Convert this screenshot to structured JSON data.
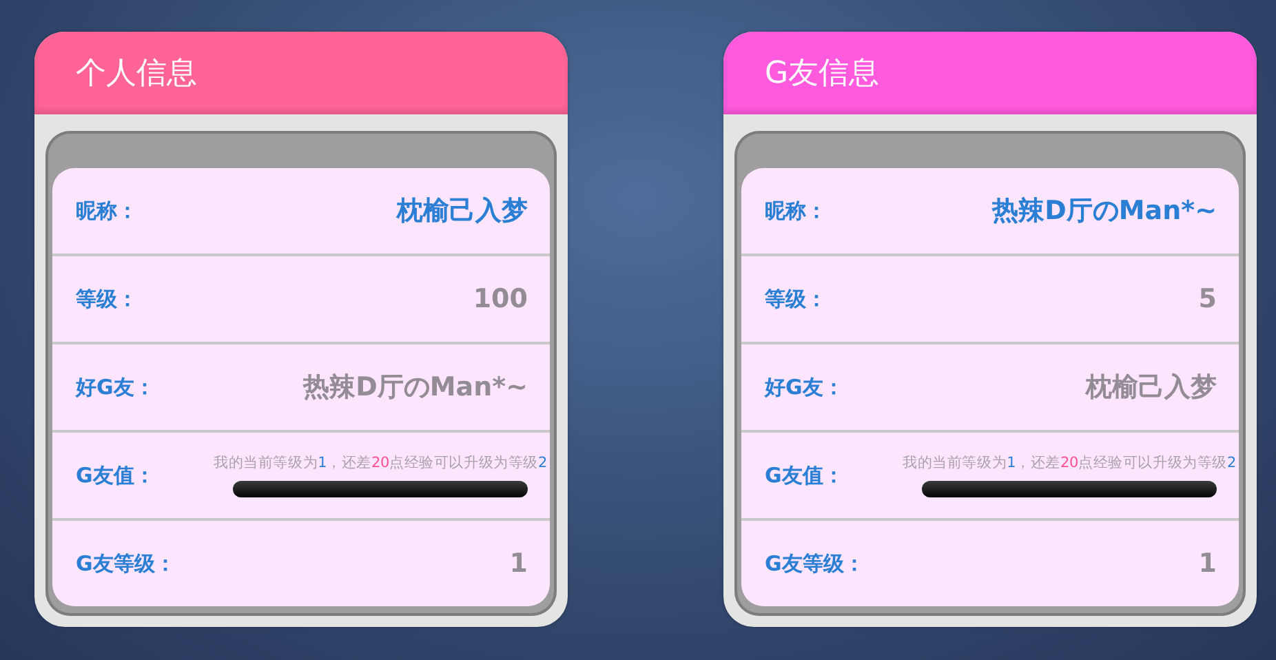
{
  "cards": [
    {
      "title": "个人信息",
      "color": "#ff6496",
      "rows": [
        {
          "kind": "name",
          "label": "昵称：",
          "value": "枕榆己入梦"
        },
        {
          "kind": "text",
          "label": "等级：",
          "value": "100"
        },
        {
          "kind": "text",
          "label": "好G友：",
          "value": "热辣D厅のMan*~"
        },
        {
          "kind": "progress",
          "label": "G友值：",
          "parts": [
            {
              "kind": "plain",
              "text": "我的当前等级为"
            },
            {
              "kind": "level",
              "text": "1"
            },
            {
              "kind": "plain",
              "text": "，还差"
            },
            {
              "kind": "points",
              "text": "20"
            },
            {
              "kind": "plain",
              "text": "点经验可以升级为等级"
            },
            {
              "kind": "level",
              "text": "2"
            }
          ],
          "level": 0
        },
        {
          "kind": "text",
          "label": "G友等级：",
          "value": "1"
        }
      ]
    },
    {
      "title": "G友信息",
      "color": "#ff5ade",
      "rows": [
        {
          "kind": "name",
          "label": "昵称：",
          "value": "热辣D厅のMan*~"
        },
        {
          "kind": "text",
          "label": "等级：",
          "value": "5"
        },
        {
          "kind": "text",
          "label": "好G友：",
          "value": "枕榆己入梦"
        },
        {
          "kind": "progress",
          "label": "G友值：",
          "parts": [
            {
              "kind": "plain",
              "text": "我的当前等级为"
            },
            {
              "kind": "level",
              "text": "1"
            },
            {
              "kind": "plain",
              "text": "，还差"
            },
            {
              "kind": "points",
              "text": "20"
            },
            {
              "kind": "plain",
              "text": "点经验可以升级为等级"
            },
            {
              "kind": "level",
              "text": "2"
            }
          ],
          "level": 0
        },
        {
          "kind": "text",
          "label": "G友等级：",
          "value": "1"
        }
      ]
    }
  ]
}
